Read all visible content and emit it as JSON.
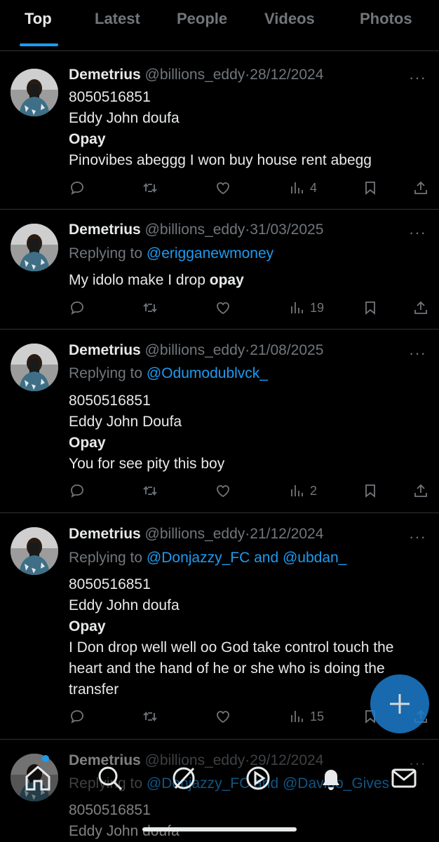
{
  "tabs": [
    "Top",
    "Latest",
    "People",
    "Videos",
    "Photos"
  ],
  "tweets": [
    {
      "name": "Demetrius",
      "handle": "@billions_eddy",
      "dot": "·",
      "date": "28/12/2024",
      "reply_prefix": "",
      "reply_to": "",
      "lines": [
        "8050516851",
        "Eddy John doufa"
      ],
      "bold_line": "Opay",
      "text": "Pinovibes abeggg I won buy house rent abegg",
      "views": "4"
    },
    {
      "name": "Demetrius",
      "handle": "@billions_eddy",
      "dot": "·",
      "date": "31/03/2025",
      "reply_prefix": "Replying to",
      "reply_to": "@erigganewmoney",
      "text_prefix": "My idolo make I drop",
      "text_bold": "opay",
      "views": "19"
    },
    {
      "name": "Demetrius",
      "handle": "@billions_eddy",
      "dot": "·",
      "date": "21/08/2025",
      "reply_prefix": "Replying to",
      "reply_to": "@Odumodublvck_",
      "lines": [
        "8050516851",
        "Eddy John Doufa"
      ],
      "bold_line": "Opay",
      "text": "You for see pity this boy",
      "views": "2"
    },
    {
      "name": "Demetrius",
      "handle": "@billions_eddy",
      "dot": "·",
      "date": "21/12/2024",
      "reply_prefix": "Replying to",
      "reply_to": "@Donjazzy_FC and @ubdan_",
      "lines": [
        "8050516851",
        "Eddy John doufa"
      ],
      "bold_line": "Opay",
      "text": "I Don drop well well oo God take control touch the heart and the hand of he or she who is doing the transfer",
      "views": "15"
    },
    {
      "name": "Demetrius",
      "handle": "@billions_eddy",
      "dot": "·",
      "date": "29/12/2024",
      "reply_prefix": "Replying to",
      "reply_to": "@Donjazzy_FC and @Davido_Gives",
      "lines": [
        "8050516851",
        "Eddy John doufa"
      ]
    }
  ],
  "more_symbol": "···",
  "icons": {
    "reply": "reply-icon",
    "retweet": "retweet-icon",
    "like": "heart-icon",
    "views": "views-icon",
    "bookmark": "bookmark-icon",
    "share": "share-icon",
    "compose": "compose-plus-icon",
    "home": "home-icon",
    "search": "search-icon",
    "grok": "grok-icon",
    "video": "video-icon",
    "notifications": "bell-icon",
    "messages": "mail-icon"
  },
  "colors": {
    "accent": "#1d9bf0",
    "muted": "#71767b",
    "text": "#e7e9ea",
    "background": "#000000"
  }
}
